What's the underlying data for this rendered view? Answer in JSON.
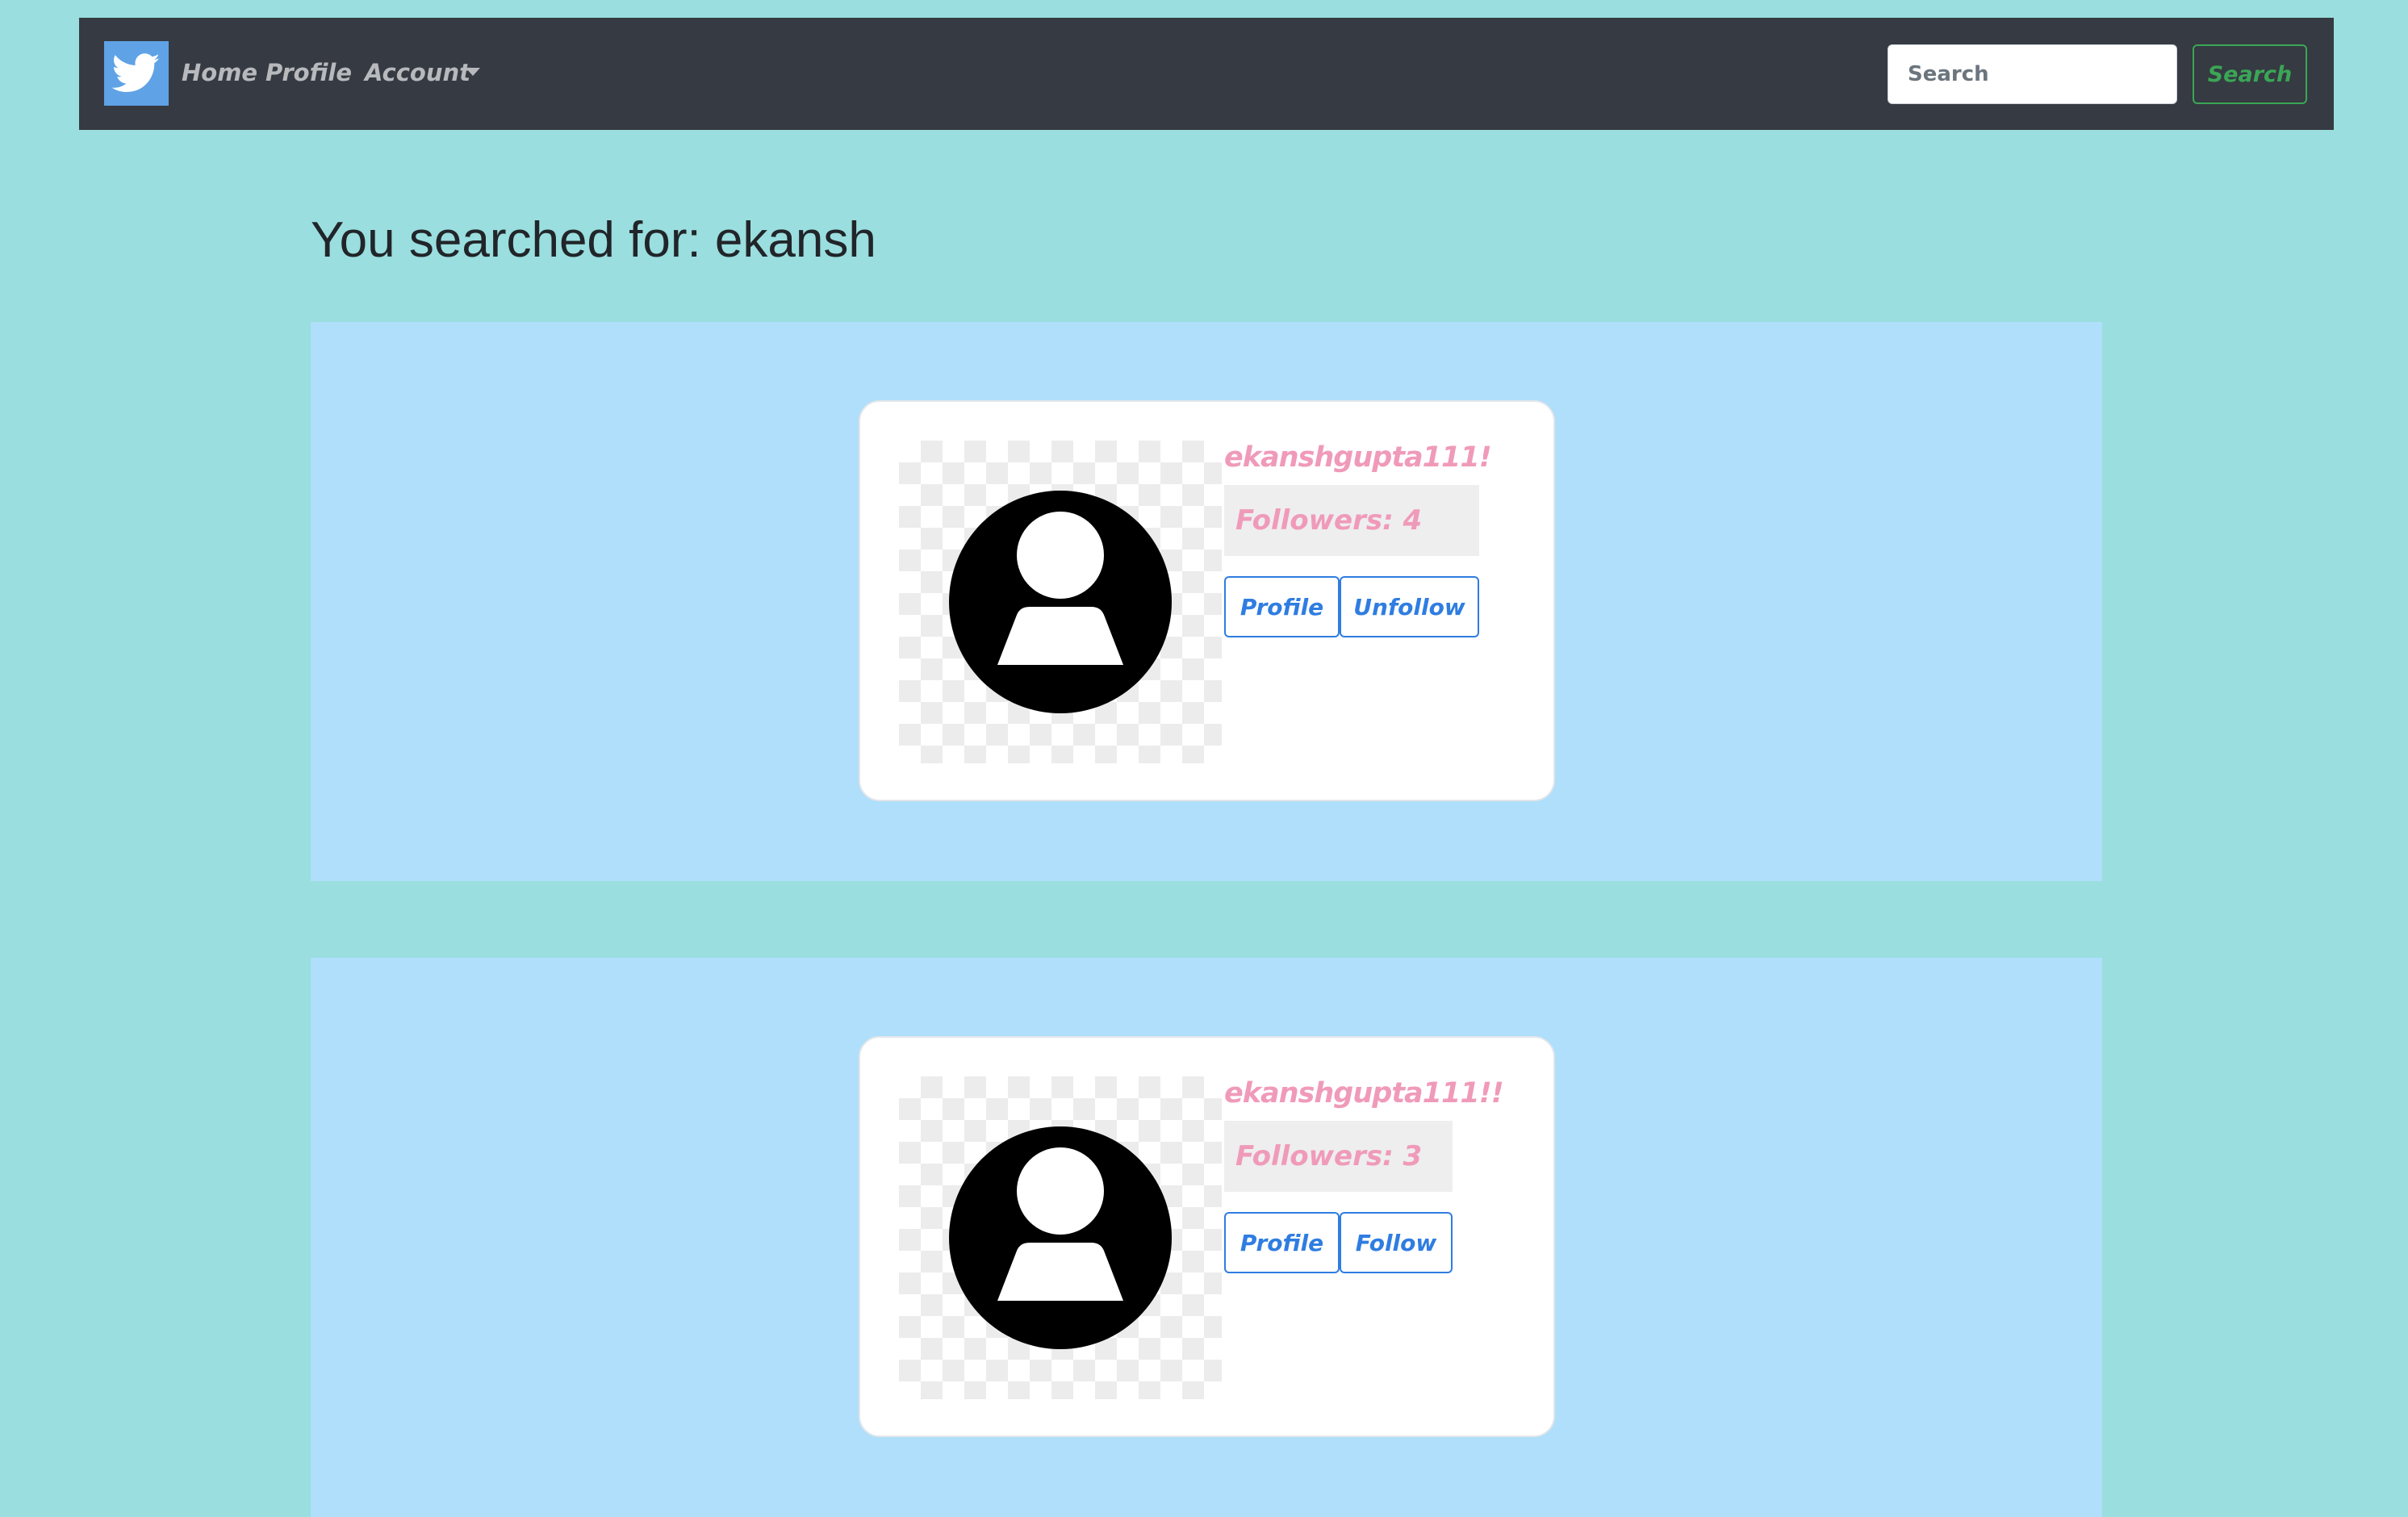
{
  "navbar": {
    "brand_icon": "twitter-bird-icon",
    "brand_color": "#5fa2e6",
    "links": [
      {
        "label": "Home"
      },
      {
        "label": "Profile"
      },
      {
        "label": "Account"
      }
    ],
    "search": {
      "placeholder": "Search",
      "value": "",
      "button_label": "Search"
    }
  },
  "main": {
    "title": "You searched for: ekansh",
    "results": [
      {
        "username": "ekanshgupta111!",
        "followers": "Followers: 4",
        "profile_label": "Profile",
        "follow_label": "Unfollow"
      },
      {
        "username": "ekanshgupta111!!",
        "followers": "Followers: 3",
        "profile_label": "Profile",
        "follow_label": "Follow"
      }
    ]
  },
  "colors": {
    "page_background": "#9adedf",
    "navbar_background": "#363a42",
    "panel_background": "#afdffa",
    "username_color": "#f09ab9",
    "button_accent": "#2f7de1",
    "search_button_accent": "#3aa656"
  }
}
